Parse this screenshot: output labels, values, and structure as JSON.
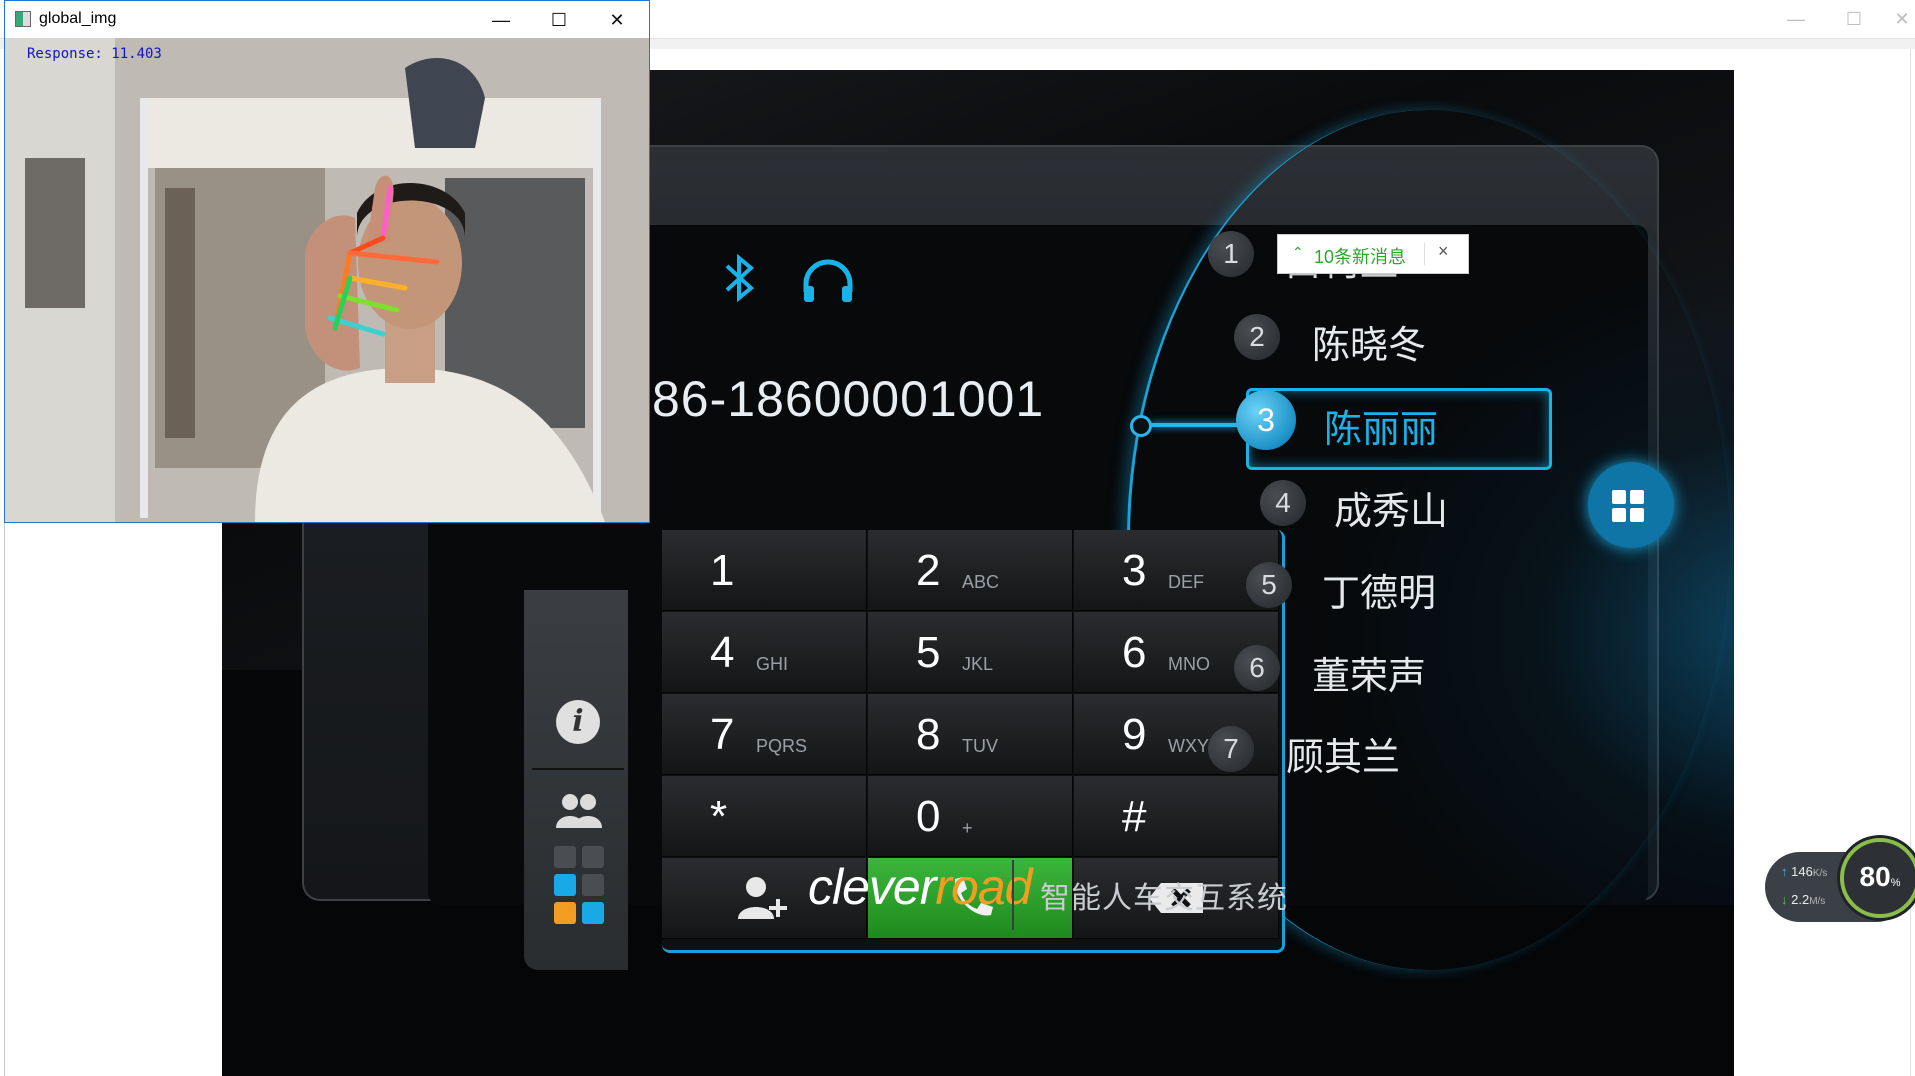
{
  "colors": {
    "accent": "#19b3ea",
    "call_green": "#2aa82a",
    "brand_orange": "#f39c24"
  },
  "global_window": {
    "title": "global_img",
    "controls": {
      "minimize": "—",
      "maximize": "☐",
      "close": "✕"
    },
    "overlay_text": "Response: 11.403"
  },
  "host_window": {
    "controls": {
      "minimize": "—",
      "maximize": "☐",
      "close": "✕"
    }
  },
  "hmi": {
    "icons": [
      "bluetooth-icon",
      "headphones-icon"
    ],
    "phone_number": "86-18600001001",
    "keypad": [
      [
        {
          "num": "1",
          "sub": ""
        },
        {
          "num": "2",
          "sub": "ABC"
        },
        {
          "num": "3",
          "sub": "DEF"
        }
      ],
      [
        {
          "num": "4",
          "sub": "GHI"
        },
        {
          "num": "5",
          "sub": "JKL"
        },
        {
          "num": "6",
          "sub": "MNO"
        }
      ],
      [
        {
          "num": "7",
          "sub": "PQRS"
        },
        {
          "num": "8",
          "sub": "TUV"
        },
        {
          "num": "9",
          "sub": "WXYZ"
        }
      ],
      [
        {
          "num": "*",
          "sub": ""
        },
        {
          "num": "0",
          "sub": "+"
        },
        {
          "num": "#",
          "sub": ""
        }
      ]
    ],
    "bottom_keys": {
      "add_contact": "add-contact-icon",
      "call": "phone-icon",
      "backspace": "backspace-icon"
    },
    "contacts": [
      {
        "num": "1",
        "name": "白柯直"
      },
      {
        "num": "2",
        "name": "陈晓冬"
      },
      {
        "num": "3",
        "name": "陈丽丽",
        "selected": true
      },
      {
        "num": "4",
        "name": "成秀山"
      },
      {
        "num": "5",
        "name": "丁德明"
      },
      {
        "num": "6",
        "name": "董荣声"
      },
      {
        "num": "7",
        "name": "顾其兰"
      }
    ],
    "logo_part1": "clever",
    "logo_part2": "road",
    "tagline": "智能人车交互系统"
  },
  "notification": {
    "text": "10条新消息",
    "close": "×"
  },
  "speed_widget": {
    "upload_value": "146",
    "upload_unit": "K/s",
    "download_value": "2.2",
    "download_unit": "M/s",
    "percent": "80",
    "percent_unit": "%"
  }
}
